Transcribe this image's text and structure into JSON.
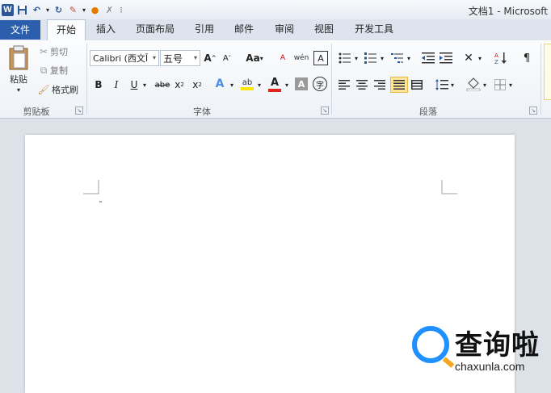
{
  "window": {
    "title": "文档1 - Microsoft"
  },
  "quick_access": [
    {
      "icon": "word-logo-icon",
      "glyph": "W"
    },
    {
      "icon": "save-icon",
      "glyph": "💾"
    },
    {
      "icon": "undo-icon",
      "glyph": "↶"
    },
    {
      "icon": "dropdown-icon",
      "glyph": "▾"
    },
    {
      "icon": "redo-icon",
      "glyph": "↻"
    },
    {
      "icon": "format-painter-quick-icon",
      "glyph": "✎"
    },
    {
      "icon": "dropdown-icon",
      "glyph": "▾"
    },
    {
      "icon": "color-icon",
      "glyph": "●"
    },
    {
      "icon": "spelling-icon",
      "glyph": "✗"
    },
    {
      "icon": "customize-icon",
      "glyph": "⁝"
    }
  ],
  "tabs": [
    {
      "label": "文件"
    },
    {
      "label": "开始"
    },
    {
      "label": "插入"
    },
    {
      "label": "页面布局"
    },
    {
      "label": "引用"
    },
    {
      "label": "邮件"
    },
    {
      "label": "审阅"
    },
    {
      "label": "视图"
    },
    {
      "label": "开发工具"
    }
  ],
  "clipboard": {
    "paste_label": "粘贴",
    "cut_label": "剪切",
    "copy_label": "复制",
    "format_painter_label": "格式刷",
    "group_label": "剪贴板"
  },
  "font": {
    "font_name": "Calibri (西文Ī",
    "font_size": "五号",
    "group_label": "字体",
    "grow_glyph": "A",
    "shrink_glyph": "A",
    "case_glyph": "Aa",
    "bold": "B",
    "italic": "I",
    "underline": "U",
    "strike": "abe",
    "subscript": "x",
    "superscript": "x",
    "text_effect": "A",
    "highlight": "ab",
    "font_color": "A",
    "char_shading": "A",
    "enclose": "字",
    "clear_format_glyph": "A",
    "phonetic_glyph": "wén",
    "border_glyph": "A"
  },
  "paragraph": {
    "group_label": "段落"
  },
  "colors": {
    "file_tab": "#2b5fad",
    "accent_red": "#e0261b",
    "highlight_yellow": "#ffe600",
    "watermark_blue": "#1e90ff"
  },
  "watermark": {
    "text": "查询啦",
    "url": "chaxunla.com"
  }
}
